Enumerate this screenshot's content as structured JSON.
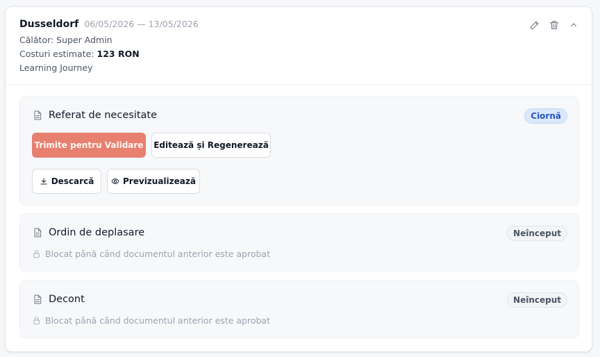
{
  "trip": {
    "title": "Dusseldorf",
    "dates": "06/05/2026 — 13/05/2026",
    "traveler_label": "Călător: Super Admin",
    "costs_label": "Costuri estimate:",
    "costs_value": "123 RON",
    "type": "Learning Journey",
    "actions": {
      "edit_icon": "pencil-icon",
      "delete_icon": "trash-icon",
      "collapse_icon": "chevron-up-icon"
    }
  },
  "documents": [
    {
      "title": "Referat de necesitate",
      "status": "Ciornă",
      "status_color": "#2556c4",
      "submit_label": "Trimite pentru Validare",
      "regenerate_label": "Editează și Regenerează",
      "download_label": "Descarcă",
      "preview_label": "Previzualizează"
    },
    {
      "title": "Ordin de deplasare",
      "status": "Neînceput",
      "locked_text": "Blocat până când documentul anterior este aprobat"
    },
    {
      "title": "Decont",
      "status": "Neînceput",
      "locked_text": "Blocat până când documentul anterior este aprobat"
    }
  ],
  "colors": {
    "primary_button": "#e8806f",
    "draft_badge_bg": "#dbe8fb"
  }
}
